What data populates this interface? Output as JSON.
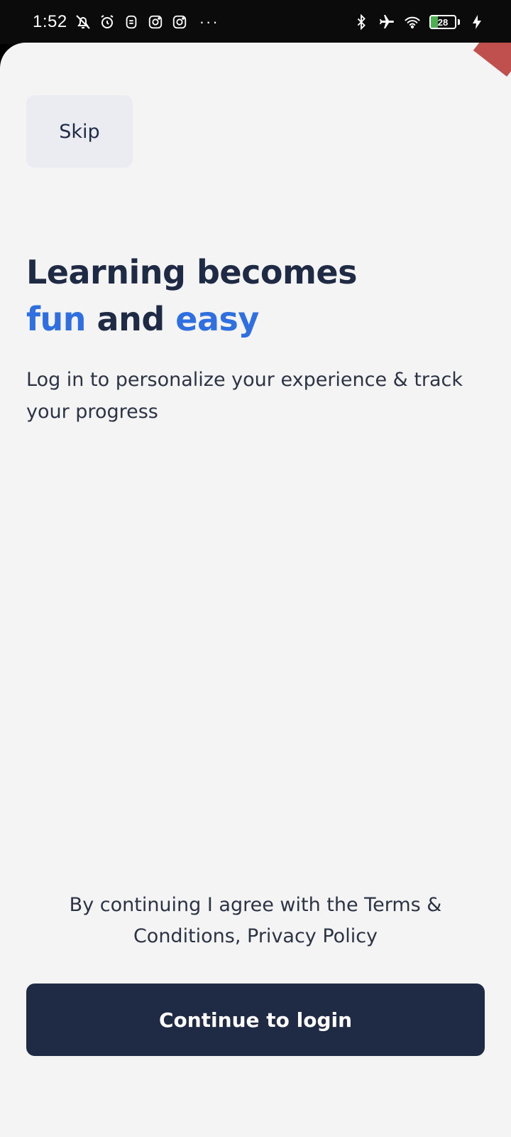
{
  "status_bar": {
    "time": "1:52",
    "left_icons": [
      "bell-off-icon",
      "alarm-icon",
      "app-notification-icon",
      "instagram-icon",
      "instagram-icon"
    ],
    "overflow": "···",
    "right_icons": [
      "bluetooth-icon",
      "airplane-icon",
      "wifi-icon"
    ],
    "battery_level": "28",
    "charging": true
  },
  "colors": {
    "primary": "#1f2a44",
    "accent": "#2f6fe0",
    "background": "#f4f4f4",
    "skip_bg": "#eaecf2"
  },
  "onboarding": {
    "skip_label": "Skip",
    "headline": {
      "line1": "Learning becomes",
      "word_fun": "fun",
      "word_and": " and ",
      "word_easy": "easy"
    },
    "subtitle": "Log in to personalize your experience & track your progress",
    "legal_text": "By continuing I agree with the Terms & Conditions, Privacy Policy",
    "cta_label": "Continue to login"
  }
}
